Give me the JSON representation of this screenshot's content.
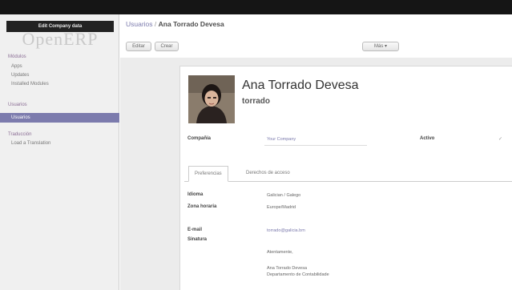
{
  "sidebar": {
    "edit_company": "Edit Company data",
    "logo_text": "OpenERP",
    "sections": [
      {
        "heading": "Módulos",
        "items": [
          "Apps",
          "Updates",
          "Installed Modules"
        ]
      },
      {
        "heading": "Usuarios",
        "items": [
          "Usuarios"
        ]
      },
      {
        "heading": "Traducción",
        "items": [
          "Load a Translation"
        ]
      }
    ],
    "active_item": "Usuarios"
  },
  "breadcrumb": {
    "parent": "Usuarios",
    "separator": "/",
    "current": "Ana Torrado Devesa"
  },
  "toolbar": {
    "edit_label": "Editar",
    "create_label": "Crear",
    "more_label": "Más ▾"
  },
  "user": {
    "name": "Ana Torrado Devesa",
    "login": "torrado"
  },
  "form": {
    "company_label": "Compañía",
    "company_value": "Your Company",
    "active_label": "Activo",
    "active_value": "✓"
  },
  "tabs": [
    "Preferencias",
    "Derechos de acceso"
  ],
  "preferences": {
    "language_label": "Idioma",
    "language_value": "Galician / Galego",
    "timezone_label": "Zona horaria",
    "timezone_value": "Europe/Madrid",
    "email_label": "E-mail",
    "email_value": "torrado@galicia.bm",
    "signature_label": "Sinatura",
    "signature_lines": [
      "Atentamente,",
      "Ana Torrado Devesa",
      "Departamento de Contabilidade"
    ]
  },
  "colors": {
    "accent": "#7c7bad",
    "topbar": "#151515",
    "sidebar_bg": "#f0f0f0"
  }
}
